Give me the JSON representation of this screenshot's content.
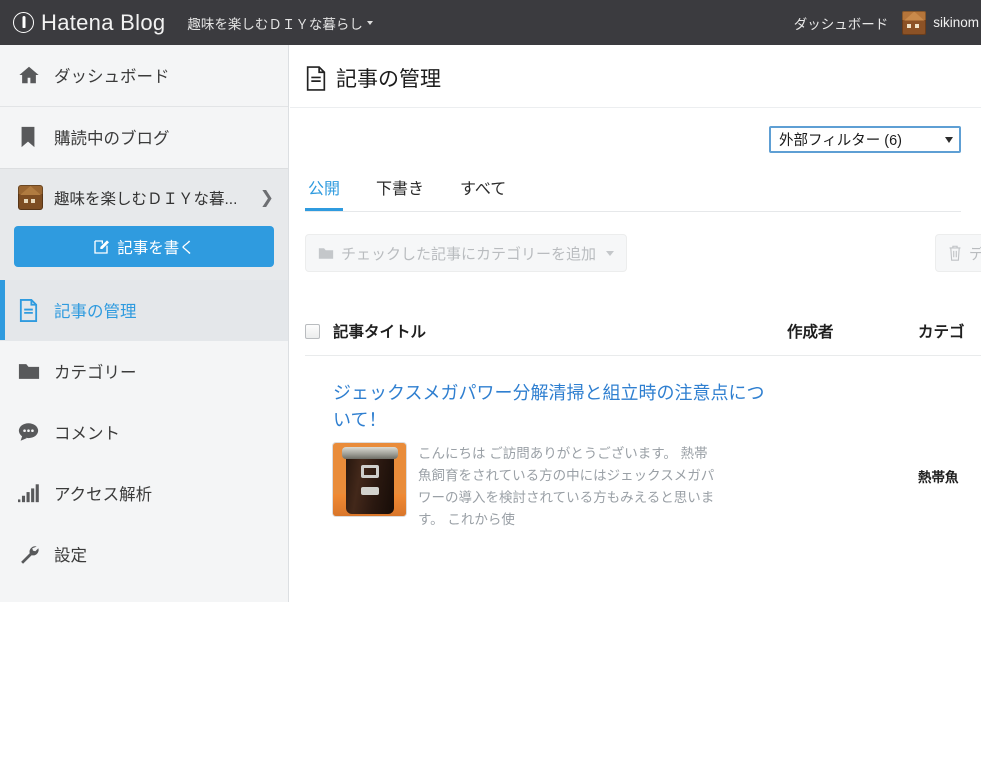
{
  "header": {
    "logo_text": "Hatena Blog",
    "logo_icon": "hatena-pen-icon",
    "blog_name": "趣味を楽しむＤＩＹな暮らし",
    "blog_caret_icon": "caret-down-icon",
    "dashboard_link": "ダッシュボード",
    "user_name": "sikinom",
    "user_avatar_icon": "house-avatar-icon"
  },
  "sidebar": {
    "items": [
      {
        "label": "ダッシュボード",
        "icon": "home-icon",
        "active": false
      },
      {
        "label": "購読中のブログ",
        "icon": "bookmark-icon",
        "active": false
      }
    ],
    "blog_switcher": {
      "name": "趣味を楽しむＤＩＹな暮...",
      "avatar_icon": "house-avatar-icon",
      "chevron_icon": "chevron-right-icon"
    },
    "write_button": {
      "label": "記事を書く",
      "icon": "pencil-square-icon"
    },
    "nav_items": [
      {
        "label": "記事の管理",
        "icon": "document-icon",
        "active": true
      },
      {
        "label": "カテゴリー",
        "icon": "folder-icon",
        "active": false
      },
      {
        "label": "コメント",
        "icon": "comment-icon",
        "active": false
      },
      {
        "label": "アクセス解析",
        "icon": "bar-chart-icon",
        "active": false
      },
      {
        "label": "設定",
        "icon": "wrench-icon",
        "active": false
      }
    ]
  },
  "main": {
    "page_title": "記事の管理",
    "page_title_icon": "document-icon",
    "filter": {
      "selected": "外部フィルター (6)",
      "caret_icon": "caret-down-icon"
    },
    "tabs": [
      {
        "label": "公開",
        "active": true
      },
      {
        "label": "下書き",
        "active": false
      },
      {
        "label": "すべて",
        "active": false
      }
    ],
    "toolbar": {
      "bulk_category_label": "チェックした記事にカテゴリーを追加",
      "bulk_category_icon": "folder-icon",
      "bulk_category_caret": "caret-down-icon",
      "delete_label": "デ",
      "delete_icon": "trash-icon"
    },
    "table": {
      "headers": {
        "select_all": "select-all-checkbox",
        "title": "記事タイトル",
        "author": "作成者",
        "category": "カテゴ"
      },
      "rows": [
        {
          "title": "ジェックスメガパワー分解清掃と組立時の注意点について！",
          "excerpt": "こんにちは ご訪問ありがとうございます。 熱帯魚飼育をされている方の中にはジェックスメガパワーの導入を検討されている方もみえると思います。 これから使",
          "thumbnail": "aquarium-filter-canister-photo",
          "category": "熱帯魚"
        }
      ]
    }
  },
  "colors": {
    "accent_blue": "#2f9bdf",
    "header_dark": "#3b3b3f",
    "sidebar_bg": "#f4f5f6",
    "link_blue": "#2f7fd0"
  }
}
